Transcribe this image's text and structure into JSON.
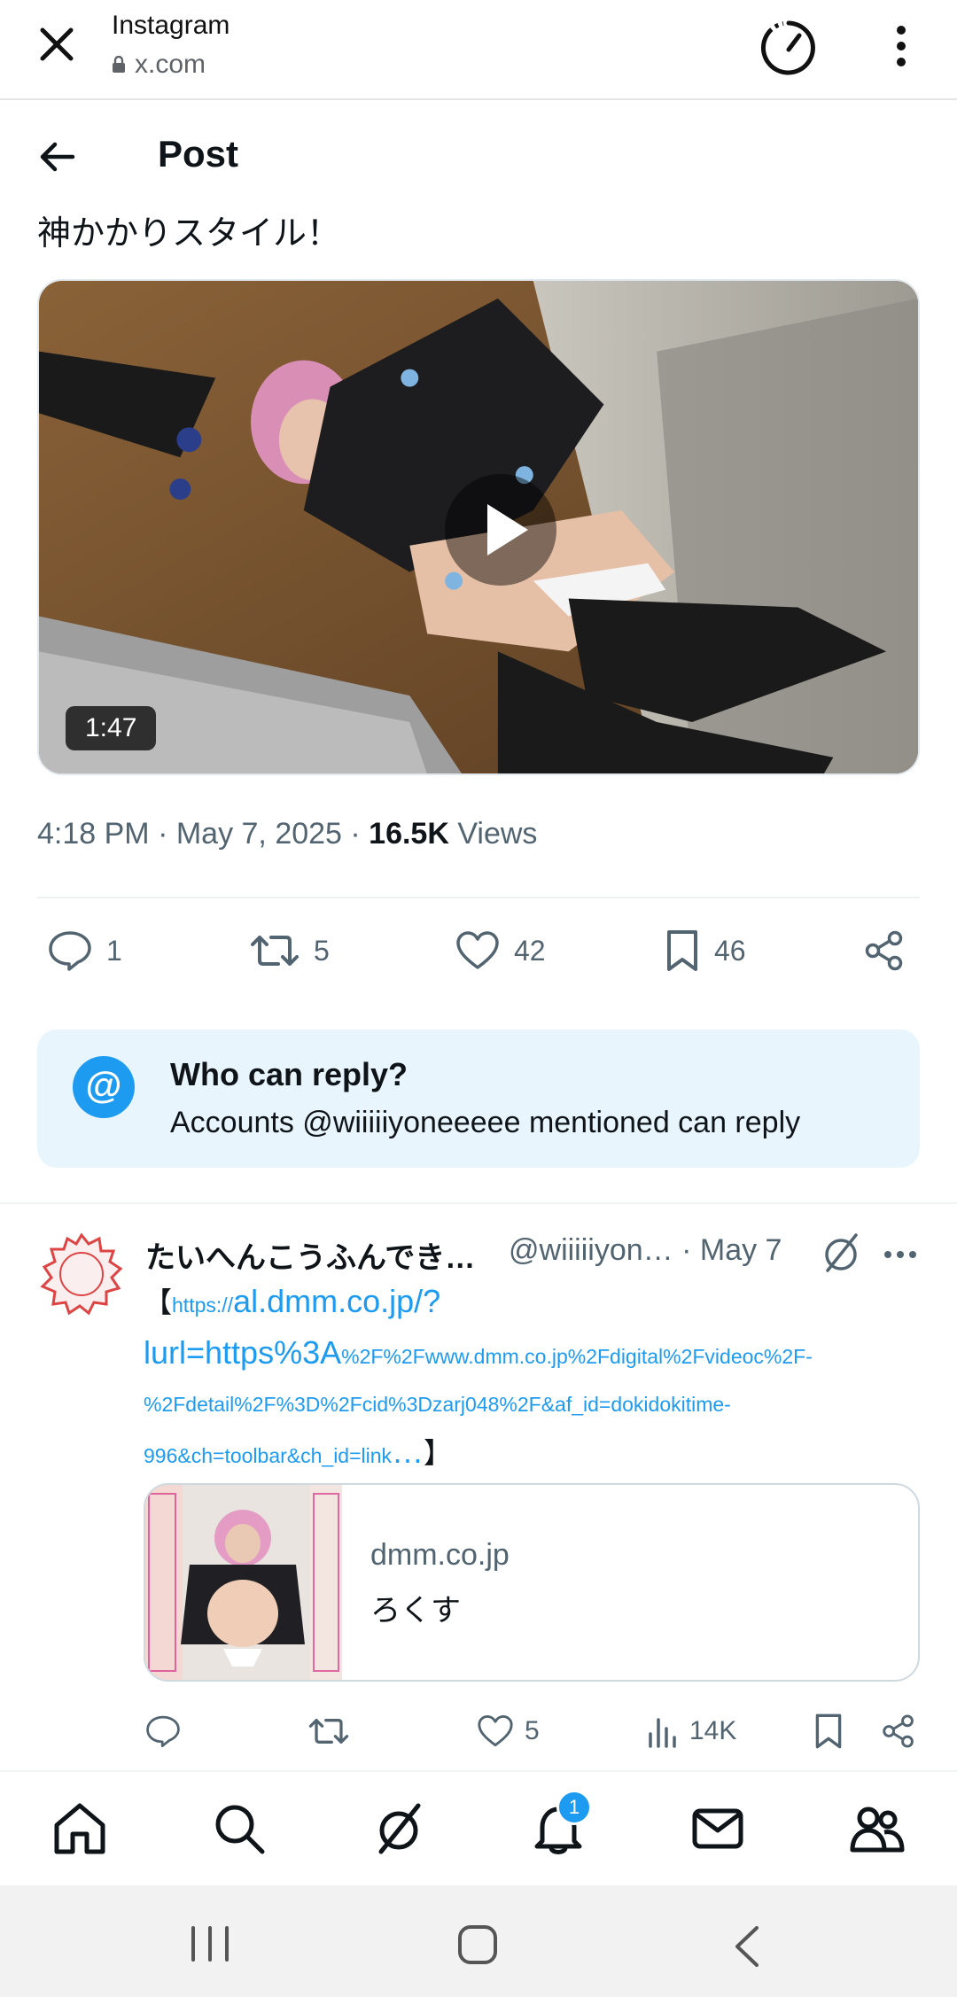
{
  "browser": {
    "title": "Instagram",
    "url": "x.com"
  },
  "header": {
    "title": "Post"
  },
  "post": {
    "text": "神かかりスタイル！",
    "video_duration": "1:47",
    "time": "4:18 PM · May 7, 2025 · ",
    "views_count": "16.5K",
    "views_label": " Views",
    "actions": {
      "replies": "1",
      "reposts": "5",
      "likes": "42",
      "bookmarks": "46"
    }
  },
  "who_can_reply": {
    "icon": "@",
    "title": "Who can reply?",
    "subtitle": "Accounts @wiiiiiyoneeeee mentioned can reply"
  },
  "reply": {
    "name": "たいへんこうふんでき…",
    "handle": "@wiiiiiyon… · May 7",
    "text_open": "【",
    "text_https": "https://",
    "text_line1": "al.dmm.co.jp/?",
    "text_line2": "lurl=https%3A",
    "text_line2_small": "%2F%2Fwww.dmm.co.jp%2Fdigital%2Fvideoc%2F-",
    "text_line3": "%2Fdetail%2F%3D%2Fcid%3Dzarj048%2F&af_id=dokidokitime-",
    "text_line4": "996&ch=toolbar&ch_id=link",
    "text_ellipsis": "…",
    "text_close": "】",
    "card": {
      "domain": "dmm.co.jp",
      "title": "ろくす"
    },
    "actions": {
      "likes": "5",
      "views": "14K"
    }
  },
  "bottom_nav": {
    "notification_badge": "1"
  },
  "colors": {
    "accent": "#1d9bf0",
    "secondary_text": "#536471",
    "who_can_reply_bg": "#e8f5fd"
  }
}
